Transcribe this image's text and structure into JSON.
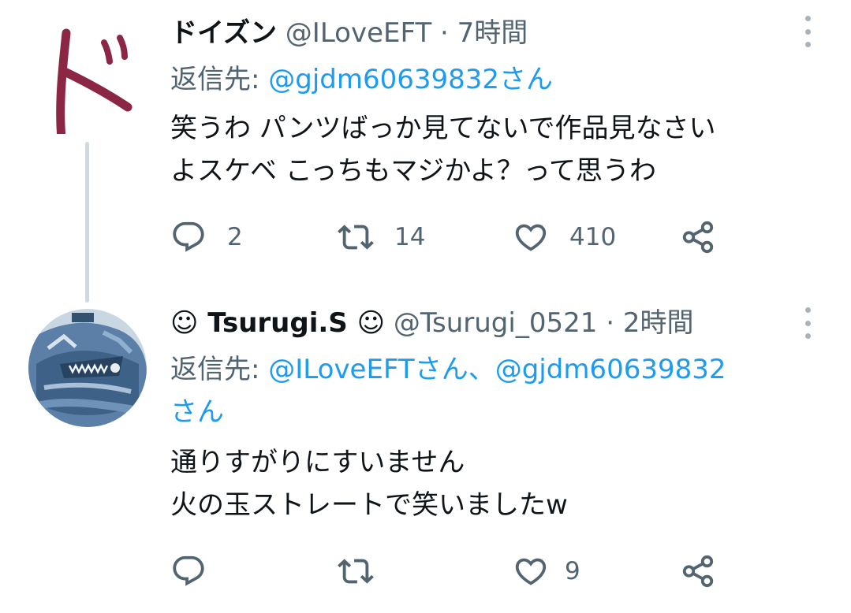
{
  "tweets": [
    {
      "name": "ドイズン",
      "handle": "@ILoveEFT",
      "separator": "·",
      "time": "7時間",
      "reply_label": "返信先: ",
      "mentions": [
        "@gjdm60639832さん"
      ],
      "body_lines": [
        "笑うわ パンツばっか見てないで作品見なさい",
        "よスケベ こっちもマジかよ？って思うわ"
      ],
      "replies": "2",
      "retweets": "14",
      "likes": "410"
    },
    {
      "name": "☺ Tsurugi.S ☺",
      "handle": "@Tsurugi_0521",
      "separator": "·",
      "time": "2時間",
      "reply_label": "返信先: ",
      "mentions": [
        "@ILoveEFTさん",
        "、",
        "@gjdm60639832",
        "さん"
      ],
      "body_lines": [
        "通りすがりにすいません",
        "火の玉ストレートで笑いましたw"
      ],
      "replies": "",
      "retweets": "",
      "likes": "9"
    }
  ],
  "icons": {
    "reply": "reply-icon",
    "retweet": "retweet-icon",
    "like": "heart-icon",
    "share": "share-icon",
    "more": "more-vertical-icon"
  },
  "colors": {
    "mention": "#1d9bf0",
    "secondary_text": "#536471",
    "avatar_1_brush": "#8b2745",
    "thread_line": "#cfd9de"
  }
}
